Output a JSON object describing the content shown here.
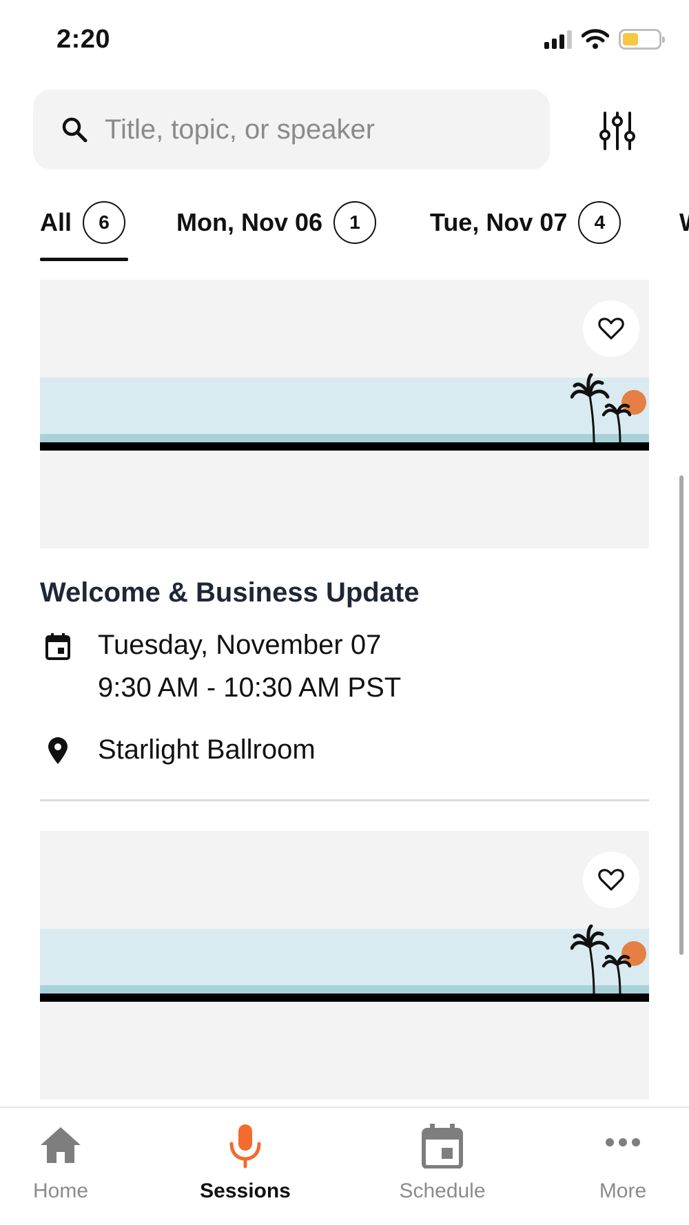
{
  "status_bar": {
    "time": "2:20"
  },
  "search": {
    "placeholder": "Title, topic, or speaker",
    "value": ""
  },
  "tabs": [
    {
      "label": "All",
      "count": "6",
      "active": true
    },
    {
      "label": "Mon, Nov 06",
      "count": "1",
      "active": false
    },
    {
      "label": "Tue, Nov 07",
      "count": "4",
      "active": false
    },
    {
      "label": "W",
      "count": "",
      "active": false
    }
  ],
  "sessions": [
    {
      "title": "Welcome & Business Update",
      "date": "Tuesday, November 07",
      "time": "9:30 AM - 10:30 AM PST",
      "location": "Starlight Ballroom",
      "favorited": false
    },
    {
      "title": "",
      "favorited": false
    }
  ],
  "bottom_nav": {
    "items": [
      {
        "label": "Home",
        "icon": "home-icon",
        "active": false
      },
      {
        "label": "Sessions",
        "icon": "microphone-icon",
        "active": true
      },
      {
        "label": "Schedule",
        "icon": "calendar-icon",
        "active": false
      },
      {
        "label": "More",
        "icon": "more-icon",
        "active": false
      }
    ]
  },
  "colors": {
    "accent": "#f26b2f",
    "sun": "#e57f43",
    "sky": "#d9eaf0",
    "water": "#a8d2da",
    "card_bg": "#f3f3f3",
    "title": "#1f2636",
    "inactive_nav": "#8b8b8b"
  }
}
